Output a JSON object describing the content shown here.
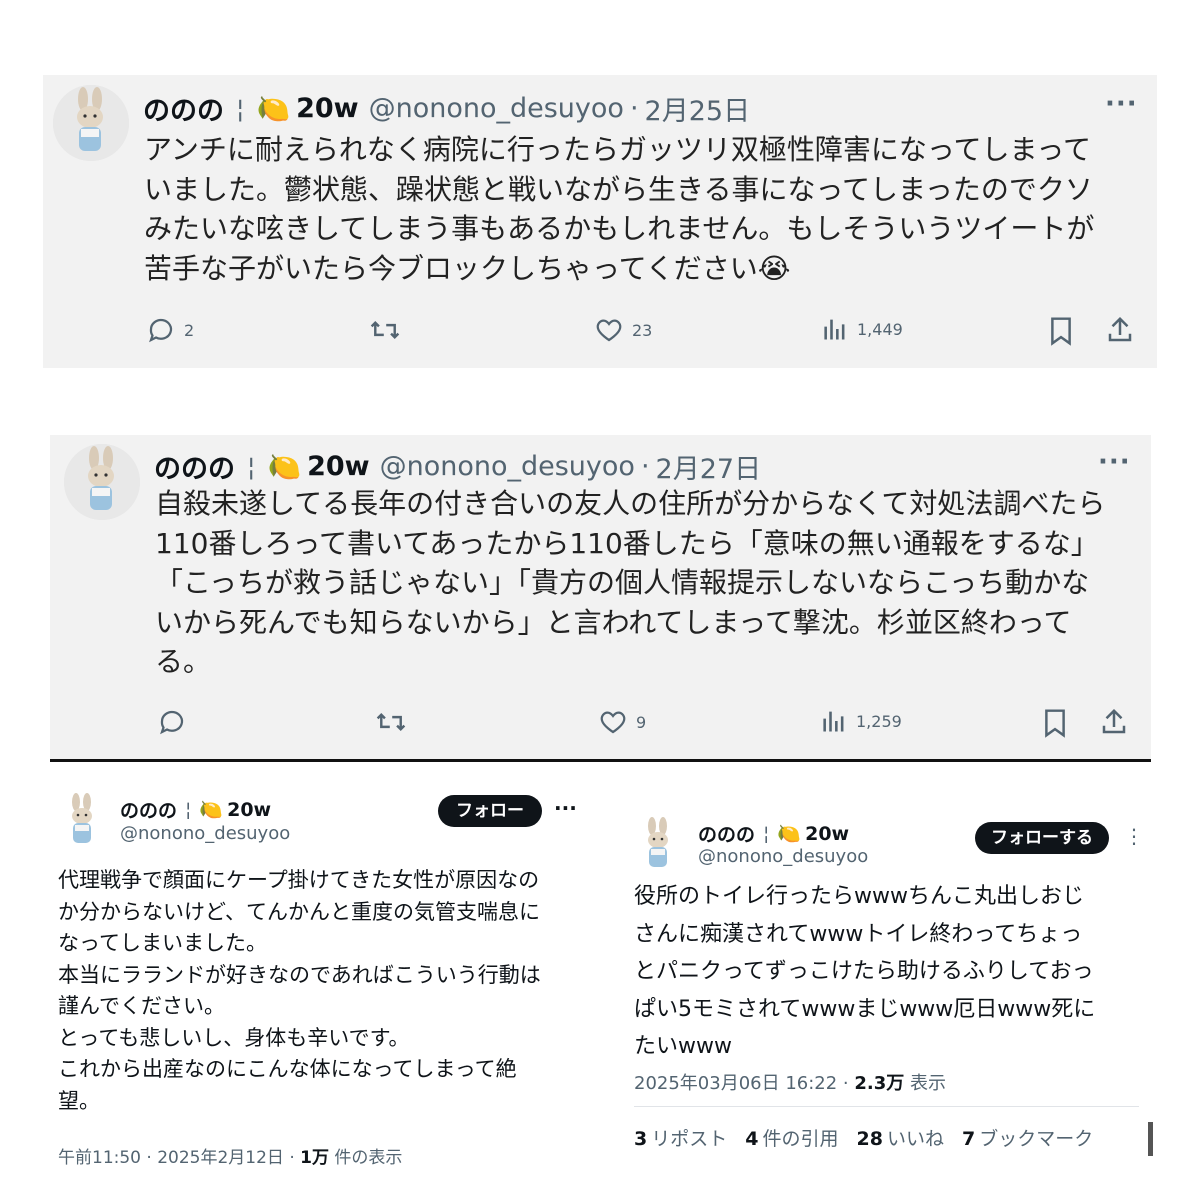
{
  "tweet1": {
    "name": "ののの",
    "separator": "¦",
    "emoji": "🍋",
    "badge": "20w",
    "handle": "@nonono_desuyoo",
    "dot": "·",
    "date": "2月25日",
    "more": "···",
    "lines": [
      "アンチに耐えられなく病院に行ったらガッツリ双極性障害になってしまって",
      "いました。鬱状態、躁状態と戦いながら生きる事になってしまったのでクソ",
      "みたいな呟きしてしまう事もあるかもしれません。もしそういうツイートが",
      "苦手な子がいたら今ブロックしちゃってください😭"
    ],
    "replies": "2",
    "retweets": "",
    "likes": "23",
    "views": "1,449"
  },
  "tweet2": {
    "name": "ののの",
    "separator": "¦",
    "emoji": "🍋",
    "badge": "20w",
    "handle": "@nonono_desuyoo",
    "dot": "·",
    "date": "2月27日",
    "more": "···",
    "lines": [
      "自殺未遂してる長年の付き合いの友人の住所が分からなくて対処法調べたら",
      "110番しろって書いてあったから110番したら「意味の無い通報をするな」",
      "「こっちが救う話じゃない」「貴方の個人情報提示しないならこっち動かな",
      "いから死んでも知らないから」と言われてしまって撃沈。杉並区終わって",
      "る。"
    ],
    "replies": "",
    "retweets": "",
    "likes": "9",
    "views": "1,259"
  },
  "tweet3": {
    "name": "ののの",
    "separator": "¦",
    "emoji": "🍋",
    "badge": "20w",
    "handle": "@nonono_desuyoo",
    "follow_label": "フォロー",
    "more": "···",
    "lines": [
      "代理戦争で顔面にケープ掛けてきた女性が原因なの",
      "か分からないけど、てんかんと重度の気管支喘息に",
      "なってしまいました。",
      "本当にラランドが好きなのであればこういう行動は",
      "謹んでください。",
      "とっても悲しいし、身体も辛いです。",
      "これから出産なのにこんな体になってしまって絶",
      "望。"
    ],
    "meta_prefix": "午前11:50 · 2025年2月12日 · ",
    "views_count": "1万",
    "views_suffix": " 件の表示"
  },
  "tweet4": {
    "name": "ののの",
    "separator": "¦",
    "emoji": "🍋",
    "badge": "20w",
    "handle": "@nonono_desuyoo",
    "follow_label": "フォローする",
    "more": "⋮",
    "lines": [
      "役所のトイレ行ったらwwwちんこ丸出しおじ",
      "さんに痴漢されてwwwトイレ終わってちょっ",
      "とパニクってずっこけたら助けるふりしておっ",
      "ぱい5モミされてwwwまじwww厄日www死に",
      "たいwww"
    ],
    "meta_prefix": "2025年03月06日 16:22 · ",
    "views_count": "2.3万",
    "views_suffix": " 表示",
    "stats": [
      {
        "num": "3",
        "label": "リポスト"
      },
      {
        "num": "4",
        "label": "件の引用"
      },
      {
        "num": "28",
        "label": "いいね"
      },
      {
        "num": "7",
        "label": "ブックマーク"
      }
    ]
  },
  "colors": {
    "card_bg": "#f2f2f2",
    "muted": "#536471",
    "text": "#0f1419",
    "button": "#0f1419"
  }
}
